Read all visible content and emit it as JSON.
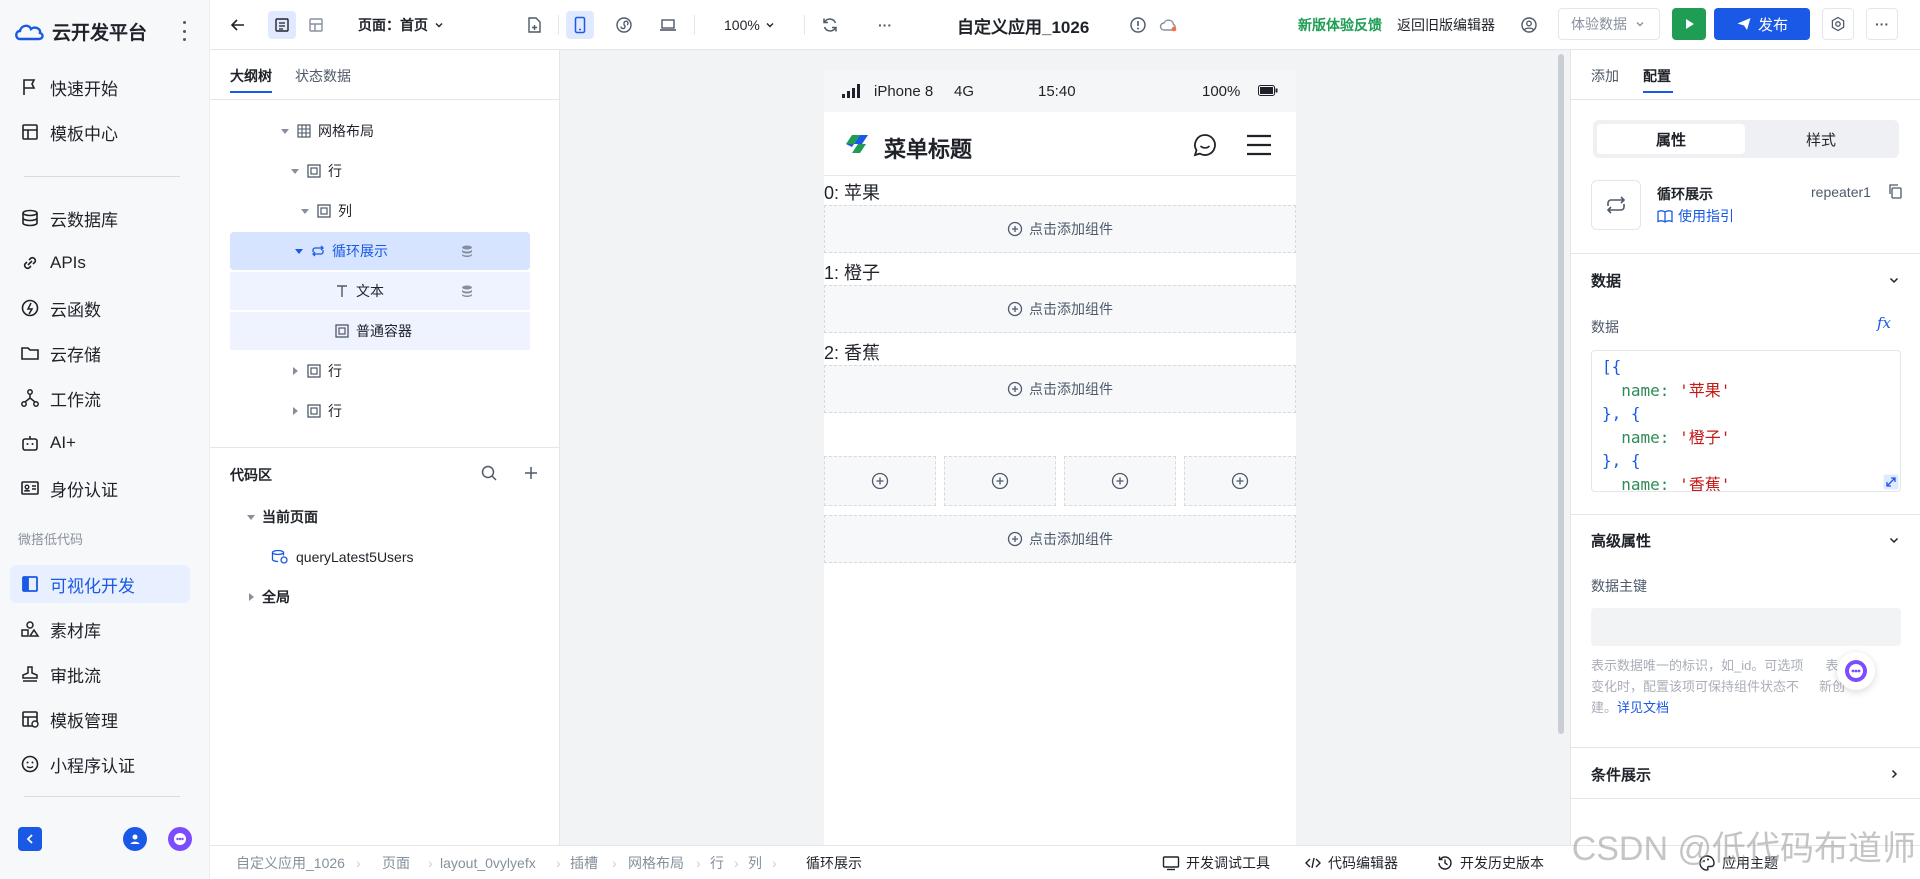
{
  "sidebar": {
    "logo_text": "云开发平台",
    "items": [
      {
        "label": "快速开始"
      },
      {
        "label": "模板中心"
      },
      {
        "label": "云数据库"
      },
      {
        "label": "APIs"
      },
      {
        "label": "云函数"
      },
      {
        "label": "云存储"
      },
      {
        "label": "工作流"
      },
      {
        "label": "AI+"
      },
      {
        "label": "身份认证"
      }
    ],
    "group_label": "微搭低代码",
    "lowcode_items": [
      {
        "label": "可视化开发"
      },
      {
        "label": "素材库"
      },
      {
        "label": "审批流"
      },
      {
        "label": "模板管理"
      },
      {
        "label": "小程序认证"
      }
    ]
  },
  "toolbar": {
    "page_label": "页面：首页",
    "zoom": "100%",
    "more": "···",
    "app_title": "自定义应用_1026",
    "feedback": "新版体验反馈",
    "back_old": "返回旧版编辑器",
    "test_data": "体验数据",
    "publish": "发布",
    "colors": {
      "accent": "#1a58e6",
      "feedback": "#1f9d55",
      "run": "#1f9d55"
    }
  },
  "outline": {
    "tabs": [
      "大纲树",
      "状态数据"
    ],
    "tree": [
      {
        "label": "网格布局"
      },
      {
        "label": "行"
      },
      {
        "label": "列"
      },
      {
        "label": "循环展示"
      },
      {
        "label": "文本"
      },
      {
        "label": "普通容器"
      },
      {
        "label": "行"
      },
      {
        "label": "行"
      }
    ],
    "code_area": {
      "title": "代码区",
      "current_page": "当前页面",
      "query": "queryLatest5Users",
      "global": "全局"
    }
  },
  "phone": {
    "carrier": "iPhone 8",
    "network": "4G",
    "time": "15:40",
    "battery": "100%",
    "title": "菜单标题",
    "items": [
      "0: 苹果",
      "1: 橙子",
      "2: 香蕉"
    ],
    "add_component": "点击添加组件"
  },
  "props": {
    "tabs": [
      "添加",
      "配置"
    ],
    "segments": [
      "属性",
      "样式"
    ],
    "component_name": "循环展示",
    "component_id": "repeater1",
    "guide_link": "使用指引",
    "data_section": "数据",
    "data_label": "数据",
    "fx": "fx",
    "code": {
      "l1": "[{",
      "l2_key": "name:",
      "l2_val": "'苹果'",
      "l3": "}, {",
      "l4_key": "name:",
      "l4_val": "'橙子'",
      "l5": "}, {",
      "l6_key": "name:",
      "l6_val": "'香蕉'"
    },
    "advanced_section": "高级属性",
    "key_label": "数据主键",
    "hint_line1": "表示数据唯一的标识，如_id。可选项",
    "hint_line1_end": "表",
    "hint_line2": "变化时，配置该项可保持组件状态不",
    "hint_line2_end": "新创",
    "hint_line3": "建。",
    "hint_link": "详见文档",
    "condition_section": "条件展示"
  },
  "bottom": {
    "breadcrumb": [
      "自定义应用_1026",
      "页面",
      "layout_0vylyefx",
      "插槽",
      "网格布局",
      "行",
      "列",
      "循环展示"
    ],
    "tools": [
      "开发调试工具",
      "代码编辑器",
      "开发历史版本",
      "应用主题"
    ]
  },
  "watermark": "CSDN @低代码布道师"
}
